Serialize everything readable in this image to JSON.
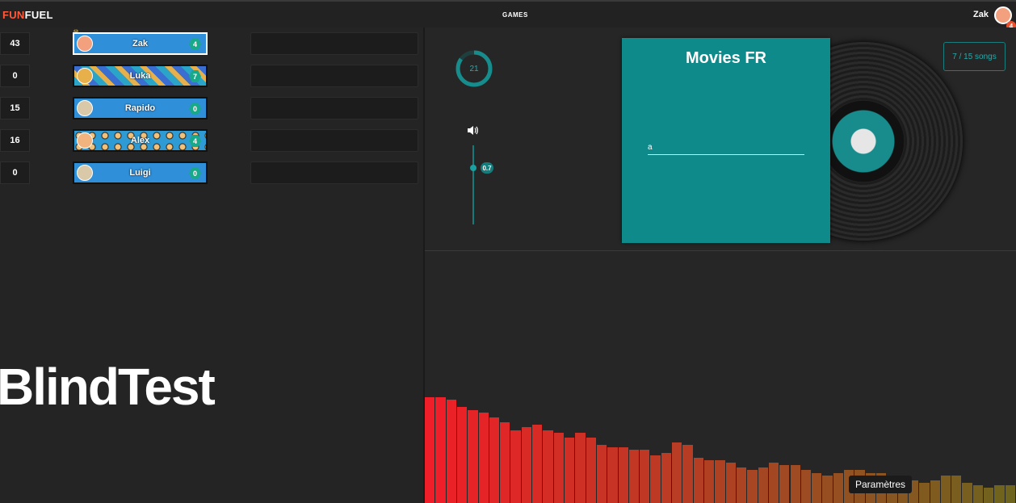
{
  "header": {
    "logo_fun": "FUN",
    "logo_fuel": "FUEL",
    "nav_games": "GAMES",
    "user_name": "Zak",
    "user_badge": "4"
  },
  "players": [
    {
      "score": "43",
      "name": "Zak",
      "badge": "4",
      "active": true
    },
    {
      "score": "0",
      "name": "Luka",
      "badge": "7",
      "active": false
    },
    {
      "score": "15",
      "name": "Rapido",
      "badge": "0",
      "active": false
    },
    {
      "score": "16",
      "name": "Alex",
      "badge": "4",
      "active": false
    },
    {
      "score": "0",
      "name": "Luigi",
      "badge": "0",
      "active": false
    }
  ],
  "brand_text": "BlindTest",
  "game": {
    "timer": "21",
    "timer_progress": 0.85,
    "volume_icon": "speaker-icon",
    "volume_value": "0.7",
    "playlist_title": "Movies FR",
    "answer_value": "a",
    "songs_progress": "7 / 15 songs"
  },
  "tooltip": "Paramètres",
  "visualizer_levels": [
    0.42,
    0.42,
    0.41,
    0.38,
    0.37,
    0.36,
    0.34,
    0.32,
    0.29,
    0.3,
    0.31,
    0.29,
    0.28,
    0.26,
    0.28,
    0.26,
    0.23,
    0.22,
    0.22,
    0.21,
    0.21,
    0.19,
    0.2,
    0.24,
    0.23,
    0.18,
    0.17,
    0.17,
    0.16,
    0.14,
    0.13,
    0.14,
    0.16,
    0.15,
    0.15,
    0.13,
    0.12,
    0.11,
    0.12,
    0.13,
    0.13,
    0.12,
    0.12,
    0.11,
    0.1,
    0.09,
    0.08,
    0.09,
    0.11,
    0.11,
    0.08,
    0.07,
    0.06,
    0.07,
    0.07
  ],
  "colors": {
    "accent": "#0f8a8a",
    "logo_red": "#ff5a3c",
    "badge_green": "#1aa88a",
    "player_blue": "#2f8fd9"
  }
}
